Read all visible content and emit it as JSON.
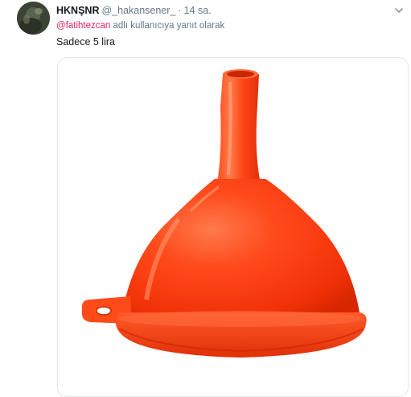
{
  "tweet": {
    "display_name": "HKNŞNR",
    "handle": "@_hakansener_",
    "separator": "·",
    "time": "14 sa.",
    "reply_mention": "@fatihtezcan",
    "reply_suffix": "adlı kullanıcıya yanıt olarak",
    "text": "Sadece 5 lira",
    "menu_icon": "chevron-down-icon",
    "media_subject": "orange plastic funnel"
  },
  "colors": {
    "name": "#14171a",
    "secondary": "#657786",
    "mention": "#e0245e",
    "funnel": "#ff3a12",
    "border": "#e1e8ed"
  }
}
